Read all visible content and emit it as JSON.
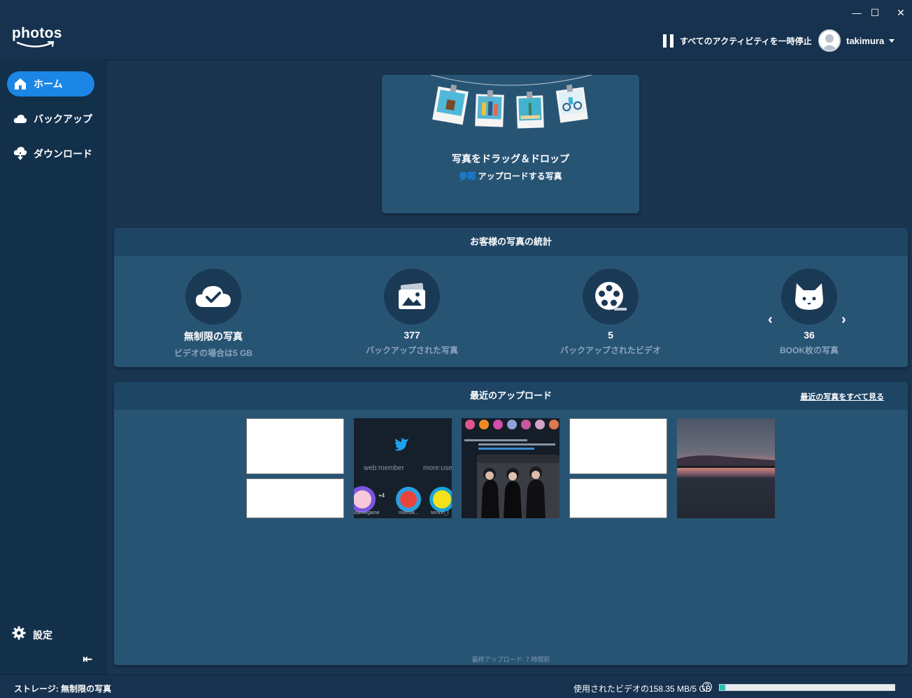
{
  "window": {
    "minimize": "—",
    "maximize": "☐",
    "close": "✕"
  },
  "header": {
    "logo_text": "photos",
    "pause_label": "すべてのアクティビティを一時停止",
    "user_name": "takimura"
  },
  "sidebar": {
    "items": [
      {
        "label": "ホーム",
        "icon": "home-icon",
        "active": true
      },
      {
        "label": "バックアップ",
        "icon": "cloud-icon",
        "active": false
      },
      {
        "label": "ダウンロード",
        "icon": "cloud-download-icon",
        "active": false
      }
    ],
    "settings_label": "設定",
    "collapse_glyph": "⇤"
  },
  "drop": {
    "title": "写真をドラッグ＆ドロップ",
    "browse": "参照",
    "suffix": " アップロードする写真"
  },
  "stats": {
    "title": "お客様の写真の統計",
    "items": [
      {
        "value": "無制限の写真",
        "label": "ビデオの場合は5 GB",
        "icon": "cloud-check-icon"
      },
      {
        "value": "377",
        "label": "バックアップされた写真",
        "icon": "photo-icon"
      },
      {
        "value": "5",
        "label": "バックアップされたビデオ",
        "icon": "film-reel-icon"
      },
      {
        "value": "36",
        "label": "BOOK枚の写真",
        "icon": "cat-icon"
      }
    ],
    "prev": "‹",
    "next": "›"
  },
  "recent": {
    "title": "最近のアップロード",
    "see_all": "最近の写真をすべて見る",
    "thumb_texts": {
      "web_member": "web:member",
      "more_user": "more:user",
      "name1": "idamegame",
      "name2": "momok...",
      "name3": "teronn_l",
      "badge": "+4"
    },
    "last_upload": "最終アップロード: 7 時間前"
  },
  "status": {
    "storage": "ストレージ: 無制限の写真",
    "usage": "使用されたビデオの158.35 MB/5 GB",
    "help": "?",
    "usage_fraction": 0.032
  },
  "colors": {
    "accent": "#1b86e6",
    "usage_bar": "#2bbfb0"
  }
}
